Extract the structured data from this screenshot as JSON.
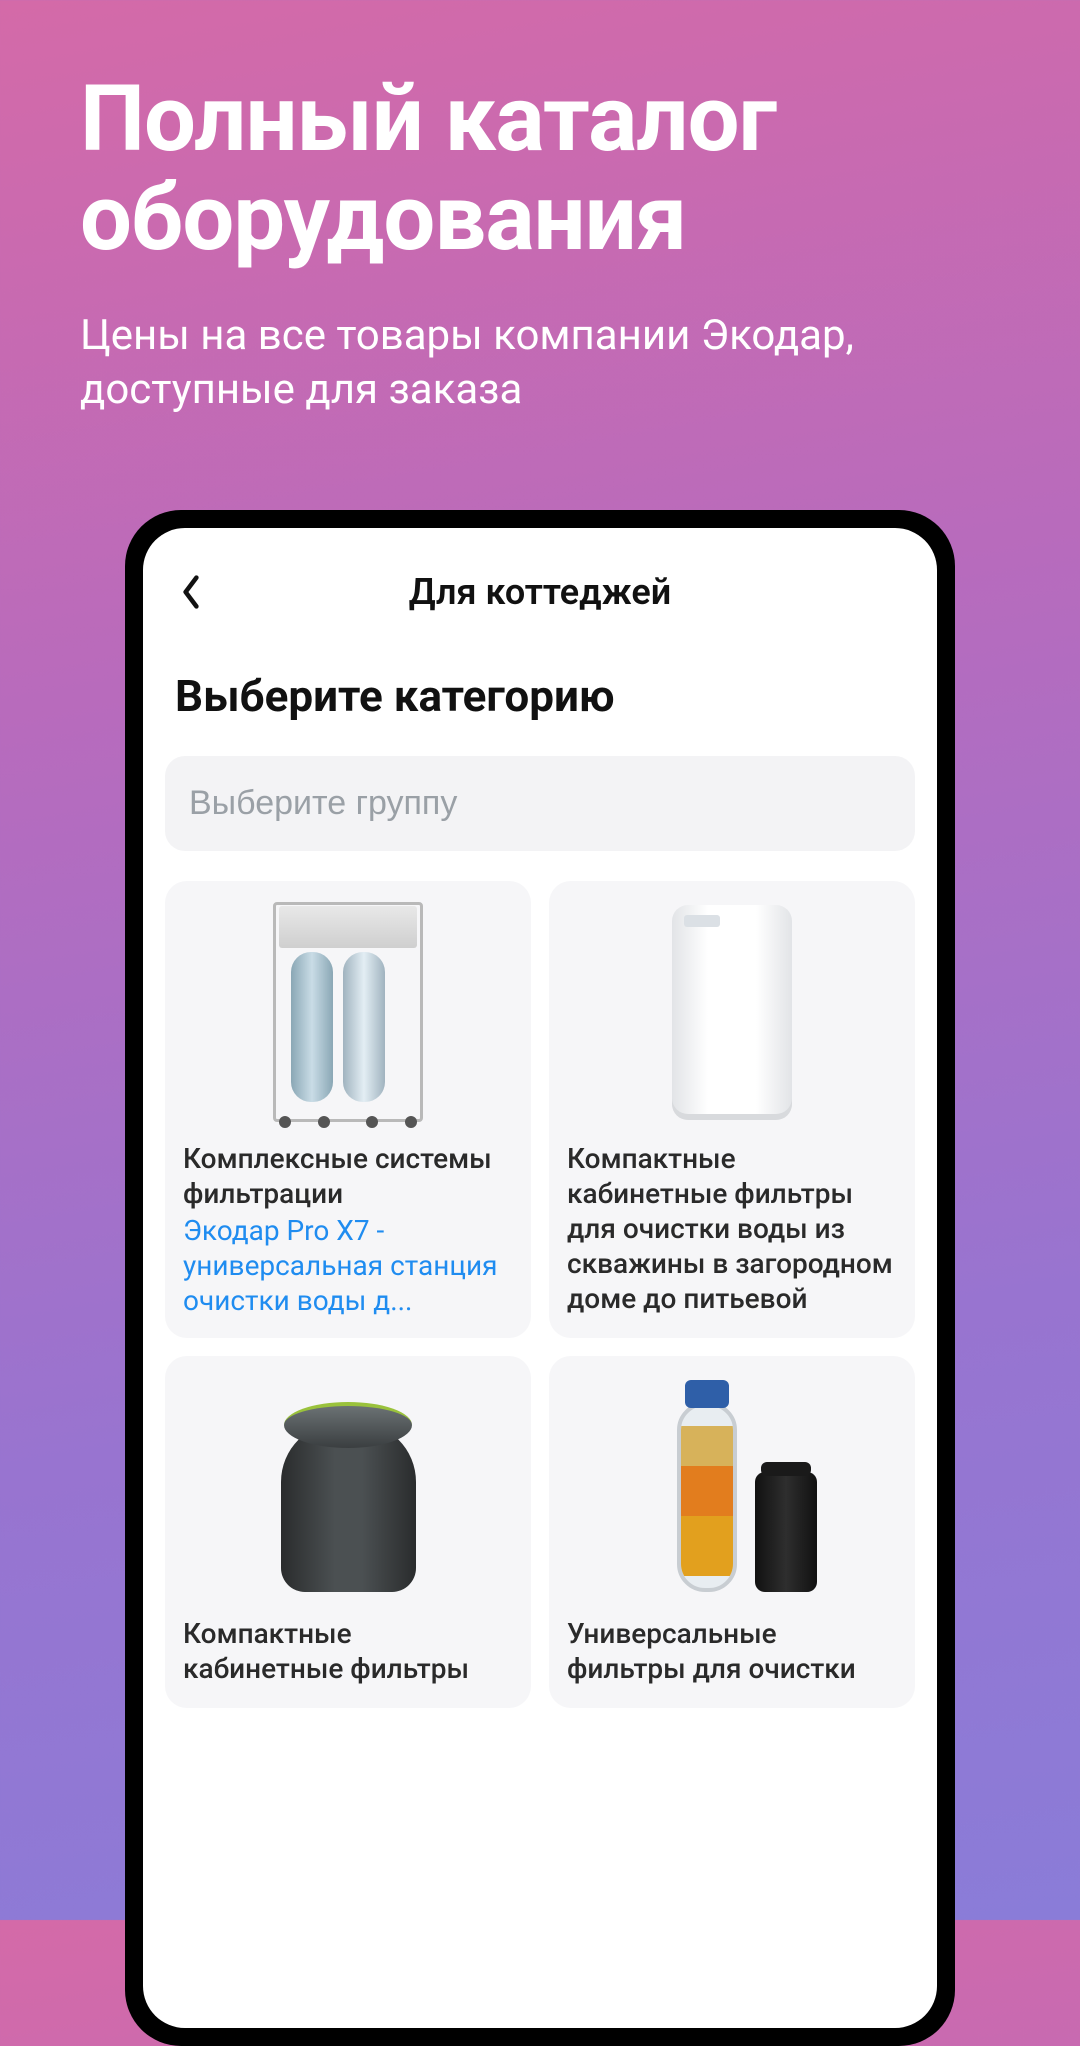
{
  "hero": {
    "title": "Полный каталог оборудования",
    "subtitle": "Цены на все товары компании Экодар, доступные для заказа"
  },
  "app": {
    "screenTitle": "Для коттеджей",
    "sectionTitle": "Выберите категорию",
    "searchPlaceholder": "Выберите группу"
  },
  "cards": [
    {
      "title": "Комплексные системы фильтрации",
      "link": "Экодар Pro X7 - универсальная станция очистки воды д..."
    },
    {
      "title": "Компактные кабинетные фильтры для очистки воды из скважины в загородном доме до питьевой",
      "link": ""
    },
    {
      "title": "Компактные кабинетные фильтры",
      "link": ""
    },
    {
      "title": "Универсальные фильтры для очистки",
      "link": ""
    }
  ]
}
